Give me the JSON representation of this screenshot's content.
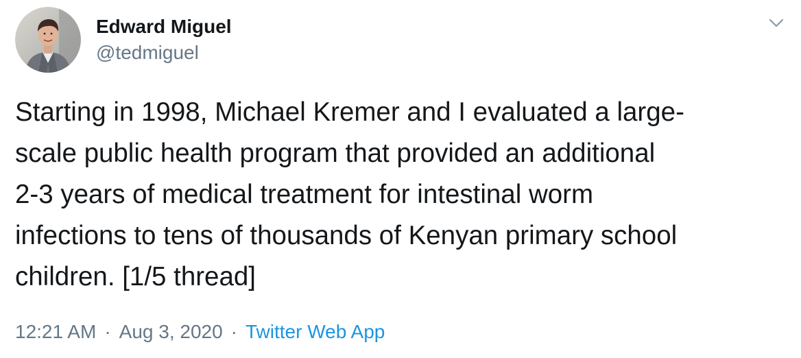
{
  "author": {
    "display_name": "Edward Miguel",
    "handle": "@tedmiguel"
  },
  "tweet": {
    "text": "Starting in 1998, Michael Kremer and I evaluated a large-\nscale public health program that provided an additional\n2-3 years of medical treatment for intestinal worm\ninfections to tens of thousands of Kenyan primary school\nchildren. [1/5 thread]",
    "time": "12:21 AM",
    "separator": "·",
    "date": "Aug 3, 2020",
    "source": "Twitter Web App"
  },
  "icons": {
    "menu": "chevron-down-icon",
    "avatar": "avatar"
  },
  "colors": {
    "text": "#14171a",
    "secondary": "#657786",
    "link": "#1b95e0"
  }
}
